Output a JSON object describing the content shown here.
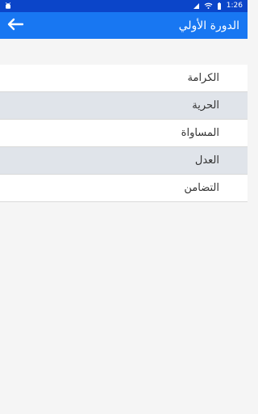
{
  "status_bar": {
    "time": "1:26",
    "icons": [
      "android-debug-icon",
      "battery-icon",
      "wifi-icon",
      "signal-icon"
    ]
  },
  "app_bar": {
    "title": "الدورة الأولي",
    "back_icon": "arrow-left-icon"
  },
  "list": {
    "items": [
      {
        "label": "الكرامة",
        "highlighted": false
      },
      {
        "label": "الحرية",
        "highlighted": true
      },
      {
        "label": "المساواة",
        "highlighted": false
      },
      {
        "label": "العدل",
        "highlighted": true
      },
      {
        "label": "التضامن",
        "highlighted": false
      }
    ]
  },
  "colors": {
    "status_bar": "#0b45c9",
    "app_bar": "#1877f2",
    "page_background": "#f5f5f5",
    "highlight_row": "#e0e4ea",
    "white_row": "#ffffff",
    "text": "#333333"
  }
}
